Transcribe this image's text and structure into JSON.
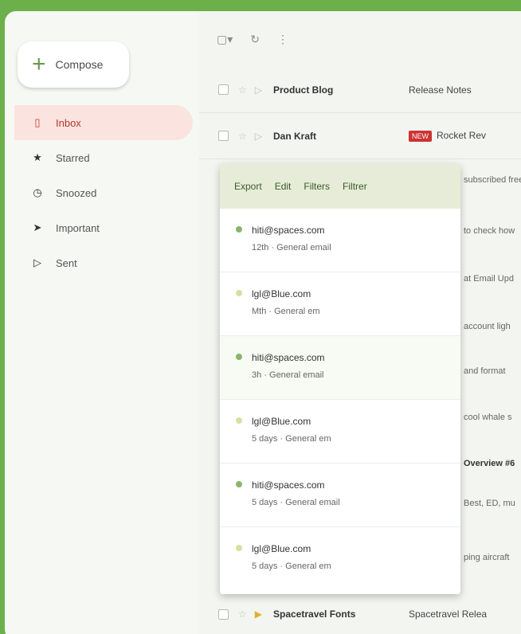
{
  "sidebar": {
    "compose_label": "Compose",
    "items": [
      {
        "label": "Inbox",
        "icon": "inbox-icon",
        "glyph": "▯"
      },
      {
        "label": "Starred",
        "icon": "star-icon",
        "glyph": "★"
      },
      {
        "label": "Snoozed",
        "icon": "clock-icon",
        "glyph": "◷"
      },
      {
        "label": "Important",
        "icon": "important-icon",
        "glyph": "➤"
      },
      {
        "label": "Sent",
        "icon": "send-icon",
        "glyph": "▷"
      }
    ]
  },
  "toolbar": {
    "select_glyph": "▢▾",
    "refresh_glyph": "↻",
    "more_glyph": "⋮"
  },
  "rows": [
    {
      "sender": "Product Blog",
      "subject": "Release Notes"
    },
    {
      "sender": "Dan Kraft",
      "tag": "NEW",
      "subject": "Rocket Rev"
    },
    {
      "sender": "Spacetravel Fonts",
      "subject": "Spacetravel Relea"
    }
  ],
  "snippets": [
    "subscribed free",
    "to check how",
    "at Email Upd",
    "account ligh",
    "and format",
    "cool whale s",
    "Overview #6",
    "Best, ED, mu",
    "ping aircraft"
  ],
  "popup": {
    "tabs": [
      "Export",
      "Edit",
      "Filters",
      "Filtrer"
    ],
    "accounts": [
      {
        "email": "hiti@spaces.com",
        "meta": "12th · General email",
        "color": "#8ab56a"
      },
      {
        "email": "lgl@Blue.com",
        "meta": "Mth · General em",
        "color": "#d9dfa0"
      },
      {
        "email": "hiti@spaces.com",
        "meta": "3h · General email",
        "color": "#8ab56a"
      },
      {
        "email": "lgl@Blue.com",
        "meta": "5 days · General em",
        "color": "#d9dfa0"
      },
      {
        "email": "hiti@spaces.com",
        "meta": "5 days · General email",
        "color": "#8ab56a"
      },
      {
        "email": "lgl@Blue.com",
        "meta": "5 days · General em",
        "color": "#d9dfa0"
      }
    ]
  }
}
